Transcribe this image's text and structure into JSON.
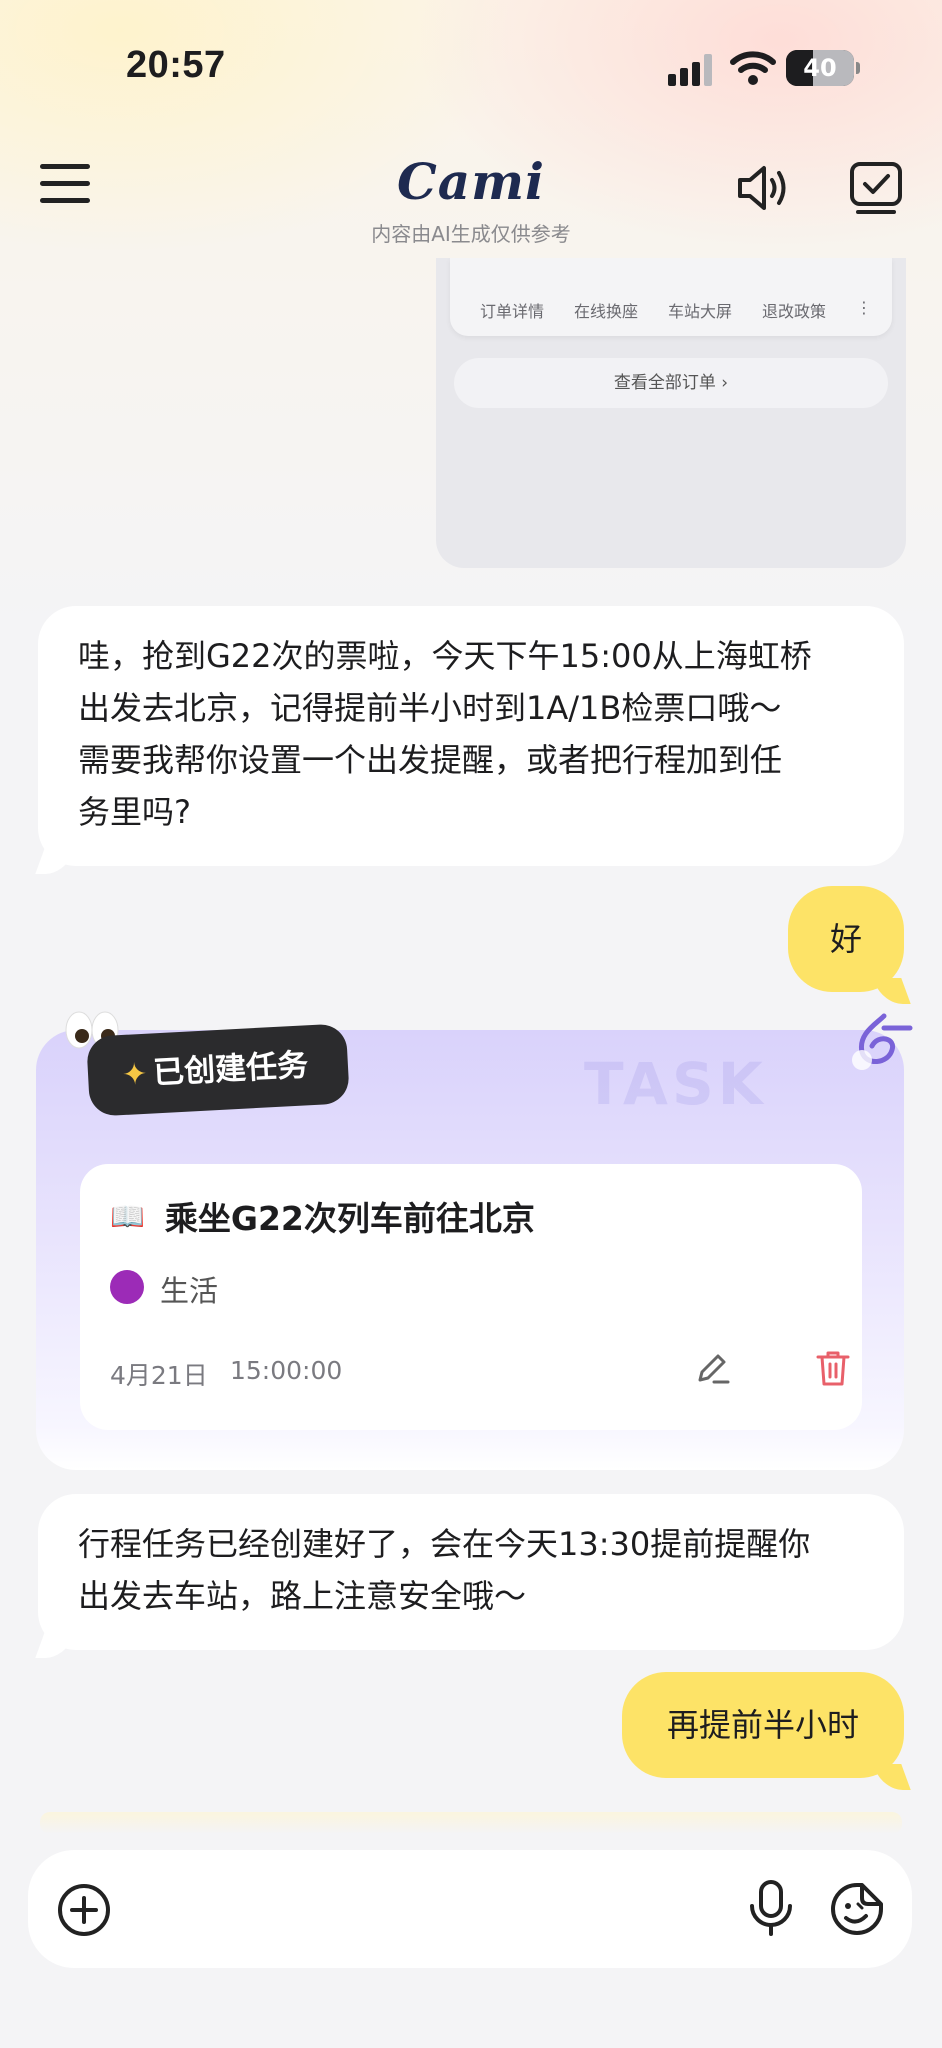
{
  "status": {
    "time": "20:57",
    "battery": "40",
    "battery_level": 0.4
  },
  "header": {
    "logo": "Cami",
    "disclaimer": "内容由AI生成仅供参考",
    "icons": [
      "menu-icon",
      "speaker-icon",
      "task-check-icon"
    ]
  },
  "order_card": {
    "tabs": [
      "订单详情",
      "在线换座",
      "车站大屏",
      "退改政策"
    ],
    "view_all": "查看全部订单 ›"
  },
  "messages": {
    "ai_1_lines": [
      "哇，抢到G22次的票啦，今天下午15:00从上海虹桥",
      "出发去北京，记得提前半小时到1A/1B检票口哦～",
      "需要我帮你设置一个出发提醒，或者把行程加到任",
      "务里吗?"
    ],
    "user_1": "好",
    "ai_2_lines": [
      "行程任务已经创建好了，会在今天13:30提前提醒你",
      "出发去车站，路上注意安全哦～"
    ],
    "user_2": "再提前半小时"
  },
  "task_card": {
    "badge": "已创建任务",
    "watermark": "TASK",
    "title": "乘坐G22次列车前往北京",
    "category": "生活",
    "category_color": "#9c2bb7",
    "date": "4月21日",
    "time": "15:00:00"
  },
  "composer": {
    "icons": [
      "plus-icon",
      "microphone-icon",
      "emoji-icon"
    ]
  },
  "colors": {
    "user_bubble": "#fde367",
    "task_card_bg": "#d9d2fb",
    "delete": "#e8606a"
  }
}
